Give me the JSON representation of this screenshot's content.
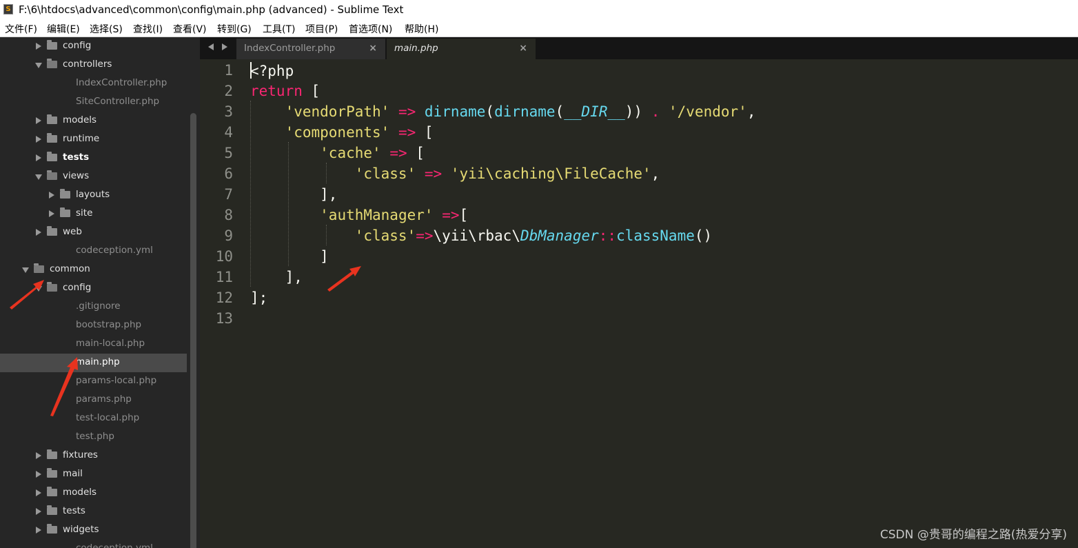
{
  "window": {
    "title": "F:\\6\\htdocs\\advanced\\common\\config\\main.php (advanced) - Sublime Text",
    "app_icon_glyph": "S"
  },
  "menu": [
    "文件(F)",
    "编辑(E)",
    "选择(S)",
    "查找(I)",
    "查看(V)",
    "转到(G)",
    "工具(T)",
    "项目(P)",
    "首选项(N)",
    "帮助(H)"
  ],
  "sidebar": {
    "items": [
      {
        "label": "config",
        "type": "folder",
        "state": "closed"
      },
      {
        "label": "controllers",
        "type": "folder",
        "state": "open"
      },
      {
        "label": "IndexController.php",
        "type": "file"
      },
      {
        "label": "SiteController.php",
        "type": "file"
      },
      {
        "label": "models",
        "type": "folder",
        "state": "closed"
      },
      {
        "label": "runtime",
        "type": "folder",
        "state": "closed"
      },
      {
        "label": "tests",
        "type": "folder",
        "state": "closed",
        "bold": true
      },
      {
        "label": "views",
        "type": "folder",
        "state": "open"
      },
      {
        "label": "layouts",
        "type": "folder",
        "state": "closed"
      },
      {
        "label": "site",
        "type": "folder",
        "state": "closed"
      },
      {
        "label": "web",
        "type": "folder",
        "state": "closed"
      },
      {
        "label": "codeception.yml",
        "type": "file"
      },
      {
        "label": "common",
        "type": "folder",
        "state": "open"
      },
      {
        "label": "config",
        "type": "folder",
        "state": "open"
      },
      {
        "label": ".gitignore",
        "type": "file"
      },
      {
        "label": "bootstrap.php",
        "type": "file"
      },
      {
        "label": "main-local.php",
        "type": "file"
      },
      {
        "label": "main.php",
        "type": "file",
        "selected": true
      },
      {
        "label": "params-local.php",
        "type": "file"
      },
      {
        "label": "params.php",
        "type": "file"
      },
      {
        "label": "test-local.php",
        "type": "file"
      },
      {
        "label": "test.php",
        "type": "file"
      },
      {
        "label": "fixtures",
        "type": "folder",
        "state": "closed"
      },
      {
        "label": "mail",
        "type": "folder",
        "state": "closed"
      },
      {
        "label": "models",
        "type": "folder",
        "state": "closed"
      },
      {
        "label": "tests",
        "type": "folder",
        "state": "closed"
      },
      {
        "label": "widgets",
        "type": "folder",
        "state": "closed"
      },
      {
        "label": "codeception.yml",
        "type": "file"
      }
    ]
  },
  "tabs": [
    {
      "label": "IndexController.php",
      "active": false,
      "close": "×"
    },
    {
      "label": "main.php",
      "active": true,
      "close": "×"
    }
  ],
  "editor": {
    "line_numbers": [
      "1",
      "2",
      "3",
      "4",
      "5",
      "6",
      "7",
      "8",
      "9",
      "10",
      "11",
      "12",
      "13"
    ],
    "lines": [
      [
        {
          "t": "<?php",
          "c": "p"
        }
      ],
      [
        {
          "t": "return",
          "c": "k"
        },
        {
          "t": " [",
          "c": "p"
        }
      ],
      [
        {
          "t": "    ",
          "c": "p"
        },
        {
          "t": "'vendorPath'",
          "c": "s"
        },
        {
          "t": " ",
          "c": "p"
        },
        {
          "t": "=>",
          "c": "k"
        },
        {
          "t": " ",
          "c": "p"
        },
        {
          "t": "dirname",
          "c": "f"
        },
        {
          "t": "(",
          "c": "p"
        },
        {
          "t": "dirname",
          "c": "f"
        },
        {
          "t": "(",
          "c": "p"
        },
        {
          "t": "__DIR__",
          "c": "c"
        },
        {
          "t": ")) ",
          "c": "p"
        },
        {
          "t": ".",
          "c": "k"
        },
        {
          "t": " ",
          "c": "p"
        },
        {
          "t": "'/vendor'",
          "c": "s"
        },
        {
          "t": ",",
          "c": "p"
        }
      ],
      [
        {
          "t": "    ",
          "c": "p"
        },
        {
          "t": "'components'",
          "c": "s"
        },
        {
          "t": " ",
          "c": "p"
        },
        {
          "t": "=>",
          "c": "k"
        },
        {
          "t": " [",
          "c": "p"
        }
      ],
      [
        {
          "t": "        ",
          "c": "p"
        },
        {
          "t": "'cache'",
          "c": "s"
        },
        {
          "t": " ",
          "c": "p"
        },
        {
          "t": "=>",
          "c": "k"
        },
        {
          "t": " [",
          "c": "p"
        }
      ],
      [
        {
          "t": "            ",
          "c": "p"
        },
        {
          "t": "'class'",
          "c": "s"
        },
        {
          "t": " ",
          "c": "p"
        },
        {
          "t": "=>",
          "c": "k"
        },
        {
          "t": " ",
          "c": "p"
        },
        {
          "t": "'yii\\caching\\FileCache'",
          "c": "s"
        },
        {
          "t": ",",
          "c": "p"
        }
      ],
      [
        {
          "t": "        ],",
          "c": "p"
        }
      ],
      [
        {
          "t": "        ",
          "c": "p"
        },
        {
          "t": "'authManager'",
          "c": "s"
        },
        {
          "t": " ",
          "c": "p"
        },
        {
          "t": "=>",
          "c": "k"
        },
        {
          "t": "[",
          "c": "p"
        }
      ],
      [
        {
          "t": "            ",
          "c": "p"
        },
        {
          "t": "'class'",
          "c": "s"
        },
        {
          "t": "=>",
          "c": "k"
        },
        {
          "t": "\\yii\\rbac\\",
          "c": "p"
        },
        {
          "t": "DbManager",
          "c": "c"
        },
        {
          "t": "::",
          "c": "k"
        },
        {
          "t": "className",
          "c": "f"
        },
        {
          "t": "()",
          "c": "p"
        }
      ],
      [
        {
          "t": "        ]",
          "c": "p"
        }
      ],
      [
        {
          "t": "    ],",
          "c": "p"
        }
      ],
      [
        {
          "t": "];",
          "c": "p"
        }
      ],
      []
    ]
  },
  "colors": {
    "keyword": "#f92672",
    "string": "#e6db74",
    "function": "#66d9ef",
    "constant": "#66d9ef",
    "plain": "#f8f8f2",
    "annotation_arrow": "#e8331f"
  },
  "watermark": "CSDN @贵哥的编程之路(热爱分享)"
}
